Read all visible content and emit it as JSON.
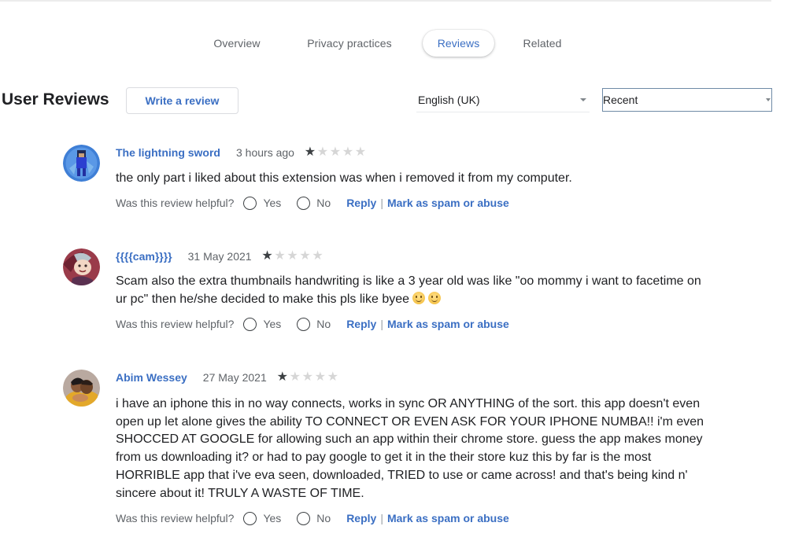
{
  "tabs": [
    {
      "label": "Overview",
      "active": false
    },
    {
      "label": "Privacy practices",
      "active": false
    },
    {
      "label": "Reviews",
      "active": true
    },
    {
      "label": "Related",
      "active": false
    }
  ],
  "header": {
    "title": "User Reviews",
    "write_review_label": "Write a review",
    "language_select": {
      "value": "English (UK)"
    },
    "sort_select": {
      "value": "Recent"
    }
  },
  "helpful": {
    "question": "Was this review helpful?",
    "yes_label": "Yes",
    "no_label": "No",
    "reply_label": "Reply",
    "separator": "|",
    "spam_label": "Mark as spam or abuse"
  },
  "accent_color": "#3b6fc3",
  "reviews": [
    {
      "author": "The lightning sword",
      "date": "3 hours ago",
      "rating": 1,
      "max_rating": 5,
      "avatar_icon": "avatar-blue-character",
      "body": "the only part i liked about this extension was when i removed it from my computer."
    },
    {
      "author": "{{{{cam}}}}",
      "date": "31 May 2021",
      "rating": 1,
      "max_rating": 5,
      "avatar_icon": "avatar-anime-character",
      "body": "Scam also the extra thumbnails handwriting is like a 3 year old was like \"oo mommy i want to facetime on ur pc\" then he/she decided to make this pls like byee",
      "emojis": [
        "slightly-smiling-face-emoji",
        "slightly-smiling-face-emoji"
      ]
    },
    {
      "author": "Abim Wessey",
      "date": "27 May 2021",
      "rating": 1,
      "max_rating": 5,
      "avatar_icon": "avatar-photo",
      "body": "i have an iphone this in no way connects, works in sync OR ANYTHING of the sort. this app doesn't even open up let alone gives the ability TO CONNECT OR EVEN ASK FOR YOUR IPHONE NUMBA!! i'm even SHOCCED AT GOOGLE for allowing such an app within their chrome store. guess the app makes money from us downloading it? or had to pay google to get it in the their store kuz this by far is the most HORRIBLE app that i've eva seen, downloaded, TRIED to use or came across! and that's being kind n' sincere about it! TRULY A WASTE OF TIME."
    }
  ]
}
